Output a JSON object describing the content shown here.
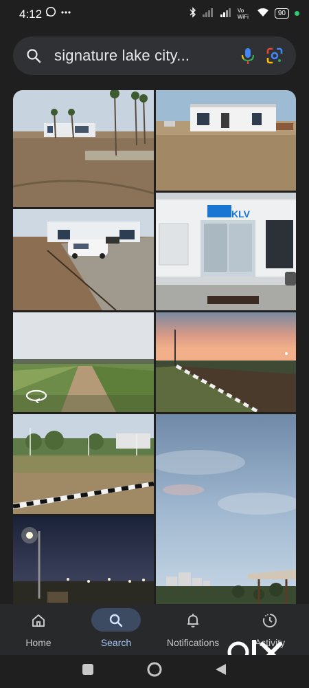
{
  "status_bar": {
    "time": "4:12",
    "network_label": "Vo WiFi",
    "battery": "90"
  },
  "search": {
    "query": "signature lake city..."
  },
  "images": [
    {
      "id": "img-1",
      "icon": "photo"
    },
    {
      "id": "img-2",
      "icon": "photo"
    },
    {
      "id": "img-3",
      "icon": "photo"
    },
    {
      "id": "img-4",
      "icon": "photo",
      "caption": "KLV"
    },
    {
      "id": "img-5",
      "icon": "photo",
      "badge_icon": "360-view-icon"
    },
    {
      "id": "img-6",
      "icon": "photo"
    },
    {
      "id": "img-7",
      "icon": "photo"
    },
    {
      "id": "img-8",
      "icon": "photo"
    },
    {
      "id": "img-9",
      "icon": "photo"
    }
  ],
  "bottom_nav": {
    "items": [
      {
        "label": "Home",
        "icon": "home-icon",
        "active": false
      },
      {
        "label": "Search",
        "icon": "search-icon",
        "active": true
      },
      {
        "label": "Notifications",
        "icon": "bell-icon",
        "active": false
      },
      {
        "label": "Activity",
        "icon": "activity-icon",
        "active": false
      }
    ]
  },
  "watermark": "olx",
  "colors": {
    "background": "#1f1f1f",
    "search_bg": "#303134",
    "accent": "#a8c7fa",
    "nav_bg": "#28292a"
  }
}
